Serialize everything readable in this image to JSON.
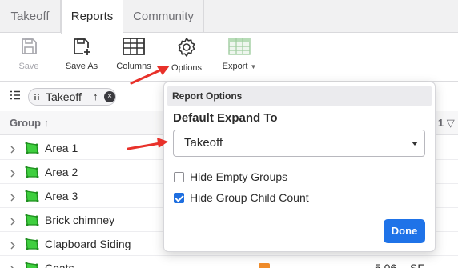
{
  "tabs": [
    {
      "label": "Takeoff",
      "active": false
    },
    {
      "label": "Reports",
      "active": true
    },
    {
      "label": "Community",
      "active": false
    }
  ],
  "toolbar": {
    "save": "Save",
    "save_as": "Save As",
    "columns": "Columns",
    "options": "Options",
    "export": "Export"
  },
  "filter": {
    "chip_label": "Takeoff",
    "chip_sort": "↑",
    "chip_remove": "×"
  },
  "table": {
    "group_header": "Group ↑",
    "right_header": "s 1",
    "rows": [
      {
        "name": "Area 1"
      },
      {
        "name": "Area 2"
      },
      {
        "name": "Area 3"
      },
      {
        "name": "Brick chimney"
      },
      {
        "name": "Clapboard Siding"
      },
      {
        "name": "Coats",
        "value": "5.06",
        "unit": "SF"
      }
    ]
  },
  "popup": {
    "title": "Report Options",
    "expand_label": "Default Expand To",
    "expand_value": "Takeoff",
    "hide_empty_groups": {
      "label": "Hide Empty Groups",
      "checked": false
    },
    "hide_child_count": {
      "label": "Hide Group Child Count",
      "checked": true
    },
    "done": "Done"
  },
  "colors": {
    "accent": "#1f73e8",
    "annotation_arrow": "#e8312a",
    "shape_green": "#2bb02b",
    "bar_orange": "#f08c2a"
  }
}
